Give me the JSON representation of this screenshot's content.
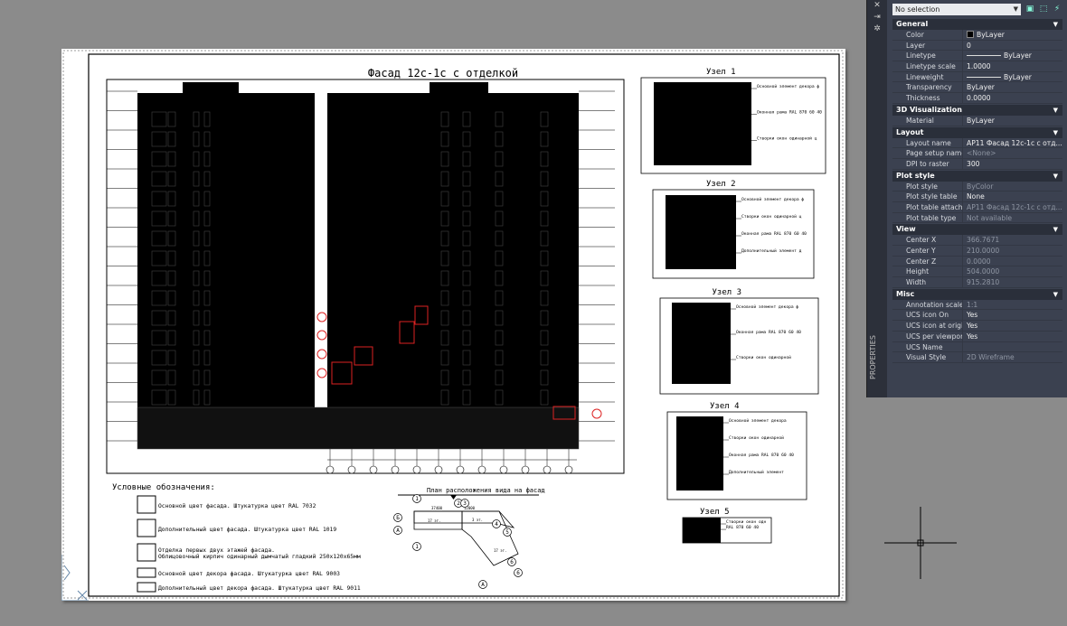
{
  "drawing": {
    "title": "Фасад 12с-1с с отделкой",
    "legend_title": "Условные обозначения:",
    "legend": [
      "Основной цвет фасада. Штукатурка цвет RAL 7032",
      "Дополнительный цвет фасада. Штукатурка цвет RAL 1019",
      "Отделка первых двух этажей фасада.",
      "Облицовочный кирпич одинарный дымчатый гладкий 250x120x65мм",
      "Основной цвет декора фасада. Штукатурка цвет RAL 9003",
      "Дополнительный цвет декора фасада. Штукатурка цвет RAL 9011"
    ],
    "plan_title": "План расположения вида на фасад",
    "plan_axes": [
      "1",
      "2",
      "3",
      "4",
      "5",
      "6",
      "Б",
      "А"
    ],
    "plan_dims": [
      "37400",
      "12000",
      "17 эт.",
      "3 эт.",
      "17 эт."
    ],
    "nodes": [
      {
        "label": "Узел 1",
        "notes": [
          "Основной элемент декора ф",
          "Оконная рама RAL 870 60 40",
          "Створки окон одинарной ц"
        ]
      },
      {
        "label": "Узел 2",
        "notes": [
          "Основной элемент декора ф",
          "Створки окон одинарной ц",
          "Оконная рама RAL 870 60 40",
          "Дополнительный элемент д"
        ]
      },
      {
        "label": "Узел 3",
        "notes": [
          "Основной элемент декора ф",
          "Оконная рама RAL 870 60 40",
          "Створки окон одинарной"
        ]
      },
      {
        "label": "Узел 4",
        "notes": [
          "Основной элемент декора",
          "Створки окон одинарной",
          "Оконная рама RAL 870 60 40",
          "Дополнительный элемент"
        ]
      },
      {
        "label": "Узел 5",
        "notes": [
          "Створки окон одн",
          "RAL 870 60 40"
        ]
      }
    ]
  },
  "panel": {
    "side_label": "PROPERTIES",
    "selection": "No selection",
    "categories": [
      {
        "name": "General",
        "rows": [
          [
            "Color",
            "ByLayer"
          ],
          [
            "Layer",
            "0"
          ],
          [
            "Linetype",
            "ByLayer"
          ],
          [
            "Linetype scale",
            "1.0000"
          ],
          [
            "Lineweight",
            "ByLayer"
          ],
          [
            "Transparency",
            "ByLayer"
          ],
          [
            "Thickness",
            "0.0000"
          ]
        ]
      },
      {
        "name": "3D Visualization",
        "rows": [
          [
            "Material",
            "ByLayer"
          ]
        ]
      },
      {
        "name": "Layout",
        "rows": [
          [
            "Layout name",
            "АР11 Фасад 12с-1с с отд..."
          ],
          [
            "Page setup name",
            "<None>"
          ],
          [
            "DPI to raster",
            "300"
          ]
        ]
      },
      {
        "name": "Plot style",
        "rows": [
          [
            "Plot style",
            "ByColor"
          ],
          [
            "Plot style table",
            "None"
          ],
          [
            "Plot table attached to",
            "АР11 Фасад 12с-1с с отд..."
          ],
          [
            "Plot table type",
            "Not available"
          ]
        ]
      },
      {
        "name": "View",
        "rows": [
          [
            "Center X",
            "366.7671"
          ],
          [
            "Center Y",
            "210.0000"
          ],
          [
            "Center Z",
            "0.0000"
          ],
          [
            "Height",
            "504.0000"
          ],
          [
            "Width",
            "915.2810"
          ]
        ]
      },
      {
        "name": "Misc",
        "rows": [
          [
            "Annotation scale",
            "1:1"
          ],
          [
            "UCS icon On",
            "Yes"
          ],
          [
            "UCS icon at origin",
            "Yes"
          ],
          [
            "UCS per viewport",
            "Yes"
          ],
          [
            "UCS Name",
            ""
          ],
          [
            "Visual Style",
            "2D Wireframe"
          ]
        ]
      }
    ]
  }
}
